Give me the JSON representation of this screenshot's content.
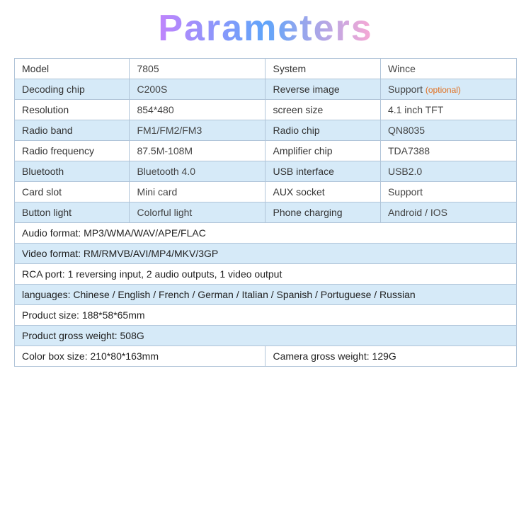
{
  "title": "Parameters",
  "rows": [
    {
      "col1_label": "Model",
      "col1_value": "7805",
      "col2_label": "System",
      "col2_value": "Wince",
      "optional": false,
      "bg": "white"
    },
    {
      "col1_label": "Decoding chip",
      "col1_value": "C200S",
      "col2_label": "Reverse image",
      "col2_value": "Support",
      "optional": true,
      "bg": "blue"
    },
    {
      "col1_label": "Resolution",
      "col1_value": "854*480",
      "col2_label": "screen size",
      "col2_value": "4.1 inch TFT",
      "optional": false,
      "bg": "white"
    },
    {
      "col1_label": "Radio band",
      "col1_value": "FM1/FM2/FM3",
      "col2_label": "Radio chip",
      "col2_value": "QN8035",
      "optional": false,
      "bg": "blue"
    },
    {
      "col1_label": "Radio frequency",
      "col1_value": "87.5M-108M",
      "col2_label": "Amplifier chip",
      "col2_value": "TDA7388",
      "optional": false,
      "bg": "white"
    },
    {
      "col1_label": "Bluetooth",
      "col1_value": "Bluetooth 4.0",
      "col2_label": "USB interface",
      "col2_value": "USB2.0",
      "optional": false,
      "bg": "blue"
    },
    {
      "col1_label": "Card slot",
      "col1_value": "Mini card",
      "col2_label": "AUX socket",
      "col2_value": "Support",
      "optional": false,
      "bg": "white"
    },
    {
      "col1_label": "Button light",
      "col1_value": "Colorful light",
      "col2_label": "Phone charging",
      "col2_value": "Android / IOS",
      "optional": false,
      "bg": "blue"
    }
  ],
  "info_rows": [
    {
      "text": "Audio format: MP3/WMA/WAV/APE/FLAC",
      "bg": "white"
    },
    {
      "text": "Video format: RM/RMVB/AVI/MP4/MKV/3GP",
      "bg": "blue"
    },
    {
      "text": "RCA port: 1 reversing input, 2 audio outputs, 1 video output",
      "bg": "white"
    },
    {
      "text": "languages: Chinese / English / French / German / Italian / Spanish / Portuguese / Russian",
      "bg": "blue"
    },
    {
      "text": "Product size: 188*58*65mm",
      "bg": "white"
    },
    {
      "text": "Product gross weight: 508G",
      "bg": "blue"
    }
  ],
  "last_row": {
    "col1": "Color box size: 210*80*163mm",
    "col2": "Camera gross weight: 129G"
  },
  "optional_label": "(optional)"
}
